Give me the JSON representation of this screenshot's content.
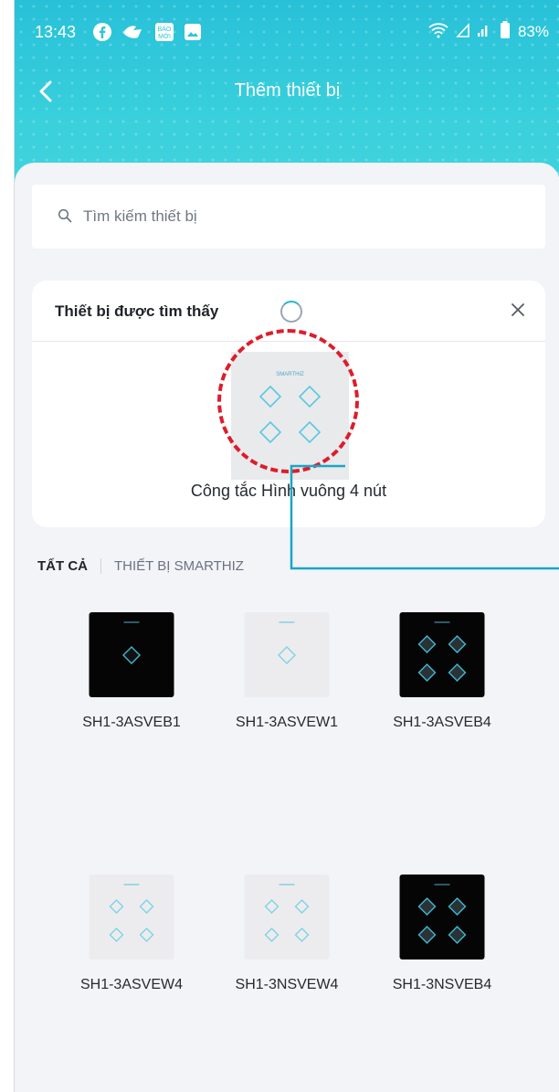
{
  "status_bar": {
    "time": "13:43",
    "battery": "83%",
    "icons": [
      "facebook-icon",
      "chat-icon",
      "news-icon",
      "gallery-icon",
      "wifi-icon",
      "signal-icon",
      "battery-icon"
    ]
  },
  "header": {
    "title": "Thêm thiết bị",
    "back_icon": "back-chevron-icon"
  },
  "search": {
    "placeholder": "Tìm kiếm thiết bị",
    "icon": "search-icon"
  },
  "found_panel": {
    "title": "Thiết bị được tìm thấy",
    "brand": "SMARTHIZ",
    "device_name": "Công tắc Hình vuông 4 nút"
  },
  "tabs": [
    {
      "label": "TẤT CẢ",
      "active": true
    },
    {
      "label": "THIẾT BỊ SMARTHIZ",
      "active": false
    }
  ],
  "devices": [
    {
      "model": "SH1-3ASVEB1",
      "color": "black",
      "buttons": 1
    },
    {
      "model": "SH1-3ASVEW1",
      "color": "white",
      "buttons": 1
    },
    {
      "model": "SH1-3ASVEB4",
      "color": "black",
      "buttons": 4
    },
    {
      "model": "SH1-3ASVEW4",
      "color": "white",
      "buttons": 4
    },
    {
      "model": "SH1-3NSVEW4",
      "color": "white",
      "buttons": 4
    },
    {
      "model": "SH1-3NSVEB4",
      "color": "black",
      "buttons": 4
    }
  ],
  "colors": {
    "accent": "#27C0D8",
    "annotation": "#DD1D2A",
    "callout": "#1AA6C6"
  }
}
